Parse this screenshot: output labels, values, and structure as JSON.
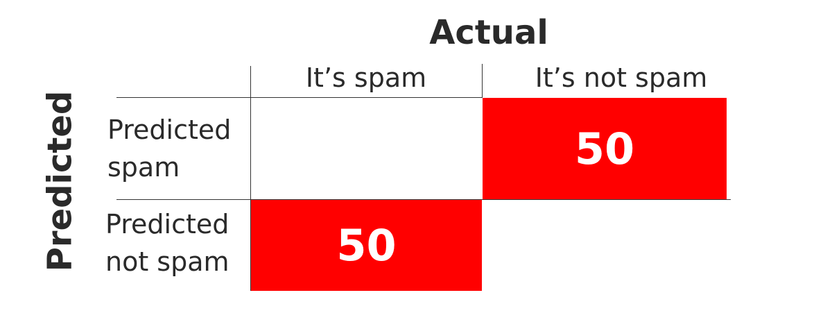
{
  "titles": {
    "actual": "Actual",
    "predicted": "Predicted"
  },
  "columns": [
    "It’s spam",
    "It’s not spam"
  ],
  "rows": [
    {
      "line1": "Predicted",
      "line2": "spam"
    },
    {
      "line1": "Predicted",
      "line2": "not spam"
    }
  ],
  "cells": {
    "predicted_spam_actual_not_spam": "50",
    "predicted_not_spam_actual_spam": "50"
  },
  "colors": {
    "highlight": "#ff0000",
    "value_text": "#ffffff",
    "text": "#2a2a2a"
  }
}
